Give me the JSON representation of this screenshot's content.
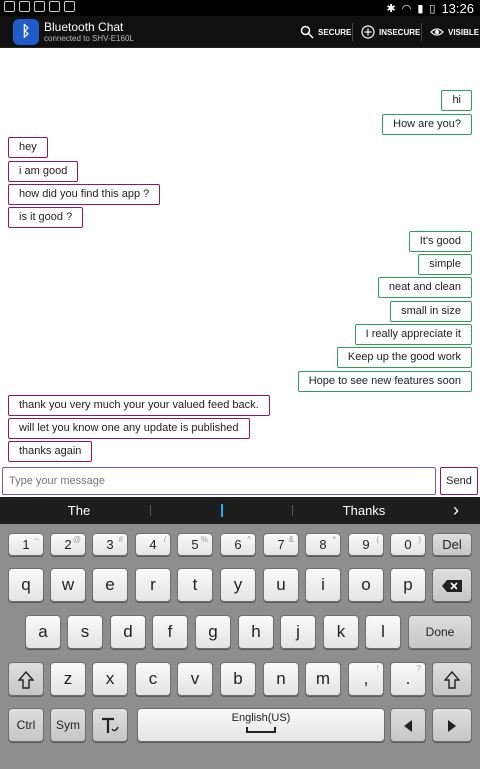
{
  "status_bar": {
    "time": "13:26"
  },
  "app": {
    "title": "Bluetooth Chat",
    "subtitle": "connected to SHV-E160L",
    "actions": {
      "secure": "SECURE",
      "insecure": "INSECURE",
      "visible": "VISIBLE"
    }
  },
  "colors": {
    "outgoing_border": "#2f9e57",
    "incoming_border": "#8c1a5f",
    "actionbar": "#101010",
    "keyboard": "#8e8e8e"
  },
  "messages": [
    {
      "dir": "out",
      "text": "hi"
    },
    {
      "dir": "out",
      "text": "How are you?"
    },
    {
      "dir": "in",
      "text": "hey"
    },
    {
      "dir": "in",
      "text": "i am good"
    },
    {
      "dir": "in",
      "text": "how did you find this app ?"
    },
    {
      "dir": "in",
      "text": "is it good ?"
    },
    {
      "dir": "out",
      "text": "It's good"
    },
    {
      "dir": "out",
      "text": "simple"
    },
    {
      "dir": "out",
      "text": "neat and clean"
    },
    {
      "dir": "out",
      "text": "small in size"
    },
    {
      "dir": "out",
      "text": "I really appreciate it"
    },
    {
      "dir": "out",
      "text": "Keep up the good work"
    },
    {
      "dir": "out",
      "text": "Hope to see new features soon"
    },
    {
      "dir": "in",
      "text": "thank you very much your your valued feed back."
    },
    {
      "dir": "in",
      "text": "will let you know one any update is published"
    },
    {
      "dir": "in",
      "text": "thanks again"
    }
  ],
  "composer": {
    "placeholder": "Type your message",
    "send_label": "Send"
  },
  "suggestions": {
    "left": "The",
    "right": "Thanks",
    "arrow": "›"
  },
  "keyboard": {
    "number_row": [
      {
        "main": "1",
        "sup": "~"
      },
      {
        "main": "2",
        "sup": "@"
      },
      {
        "main": "3",
        "sup": "#"
      },
      {
        "main": "4",
        "sup": "/"
      },
      {
        "main": "5",
        "sup": "%"
      },
      {
        "main": "6",
        "sup": "^"
      },
      {
        "main": "7",
        "sup": "&"
      },
      {
        "main": "8",
        "sup": "*"
      },
      {
        "main": "9",
        "sup": "("
      },
      {
        "main": "0",
        "sup": ")"
      },
      {
        "main": "Del",
        "sup": ""
      }
    ],
    "row1": [
      "q",
      "w",
      "e",
      "r",
      "t",
      "y",
      "u",
      "i",
      "o",
      "p"
    ],
    "row2": [
      "a",
      "s",
      "d",
      "f",
      "g",
      "h",
      "j",
      "k",
      "l"
    ],
    "row3": [
      "z",
      "x",
      "c",
      "v",
      "b",
      "n",
      "m"
    ],
    "row3_punct": [
      {
        "main": ",",
        "sup": "!"
      },
      {
        "main": ".",
        "sup": "?"
      }
    ],
    "done_label": "Done",
    "ctrl_label": "Ctrl",
    "sym_label": "Sym",
    "space_label": "English(US)"
  }
}
